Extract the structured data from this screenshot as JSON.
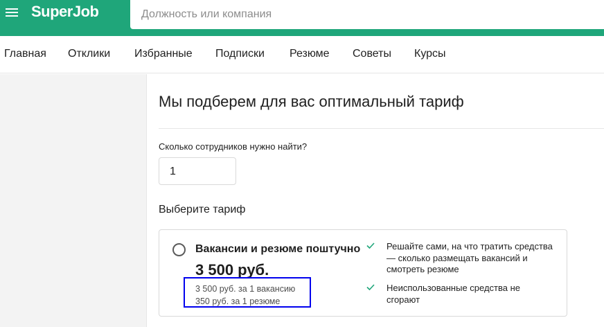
{
  "header": {
    "logo": "SuperJob",
    "search_placeholder": "Должность или компания"
  },
  "nav": {
    "items": [
      "Главная",
      "Отклики",
      "Избранные",
      "Подписки",
      "Резюме",
      "Советы",
      "Курсы"
    ]
  },
  "main": {
    "title": "Мы подберем для вас оптимальный тариф",
    "question": "Сколько сотрудников нужно найти?",
    "quantity": "1",
    "tariff_heading": "Выберите тариф",
    "card": {
      "name": "Вакансии и резюме поштучно",
      "price": "3 500 руб.",
      "detail_1": "3 500 руб. за 1 вакансию",
      "detail_2": "350 руб. за 1 резюме",
      "features": [
        {
          "icon": "check-icon",
          "text": "Решайте сами, на что тратить средства — сколько размещать вакансий и смотреть резюме"
        },
        {
          "icon": "check-icon",
          "text": "Неиспользованные средства не сгорают"
        }
      ]
    }
  },
  "colors": {
    "brand_green": "#1fa67a",
    "highlight_box": "#0000ee",
    "check_green": "#1fa67a"
  }
}
